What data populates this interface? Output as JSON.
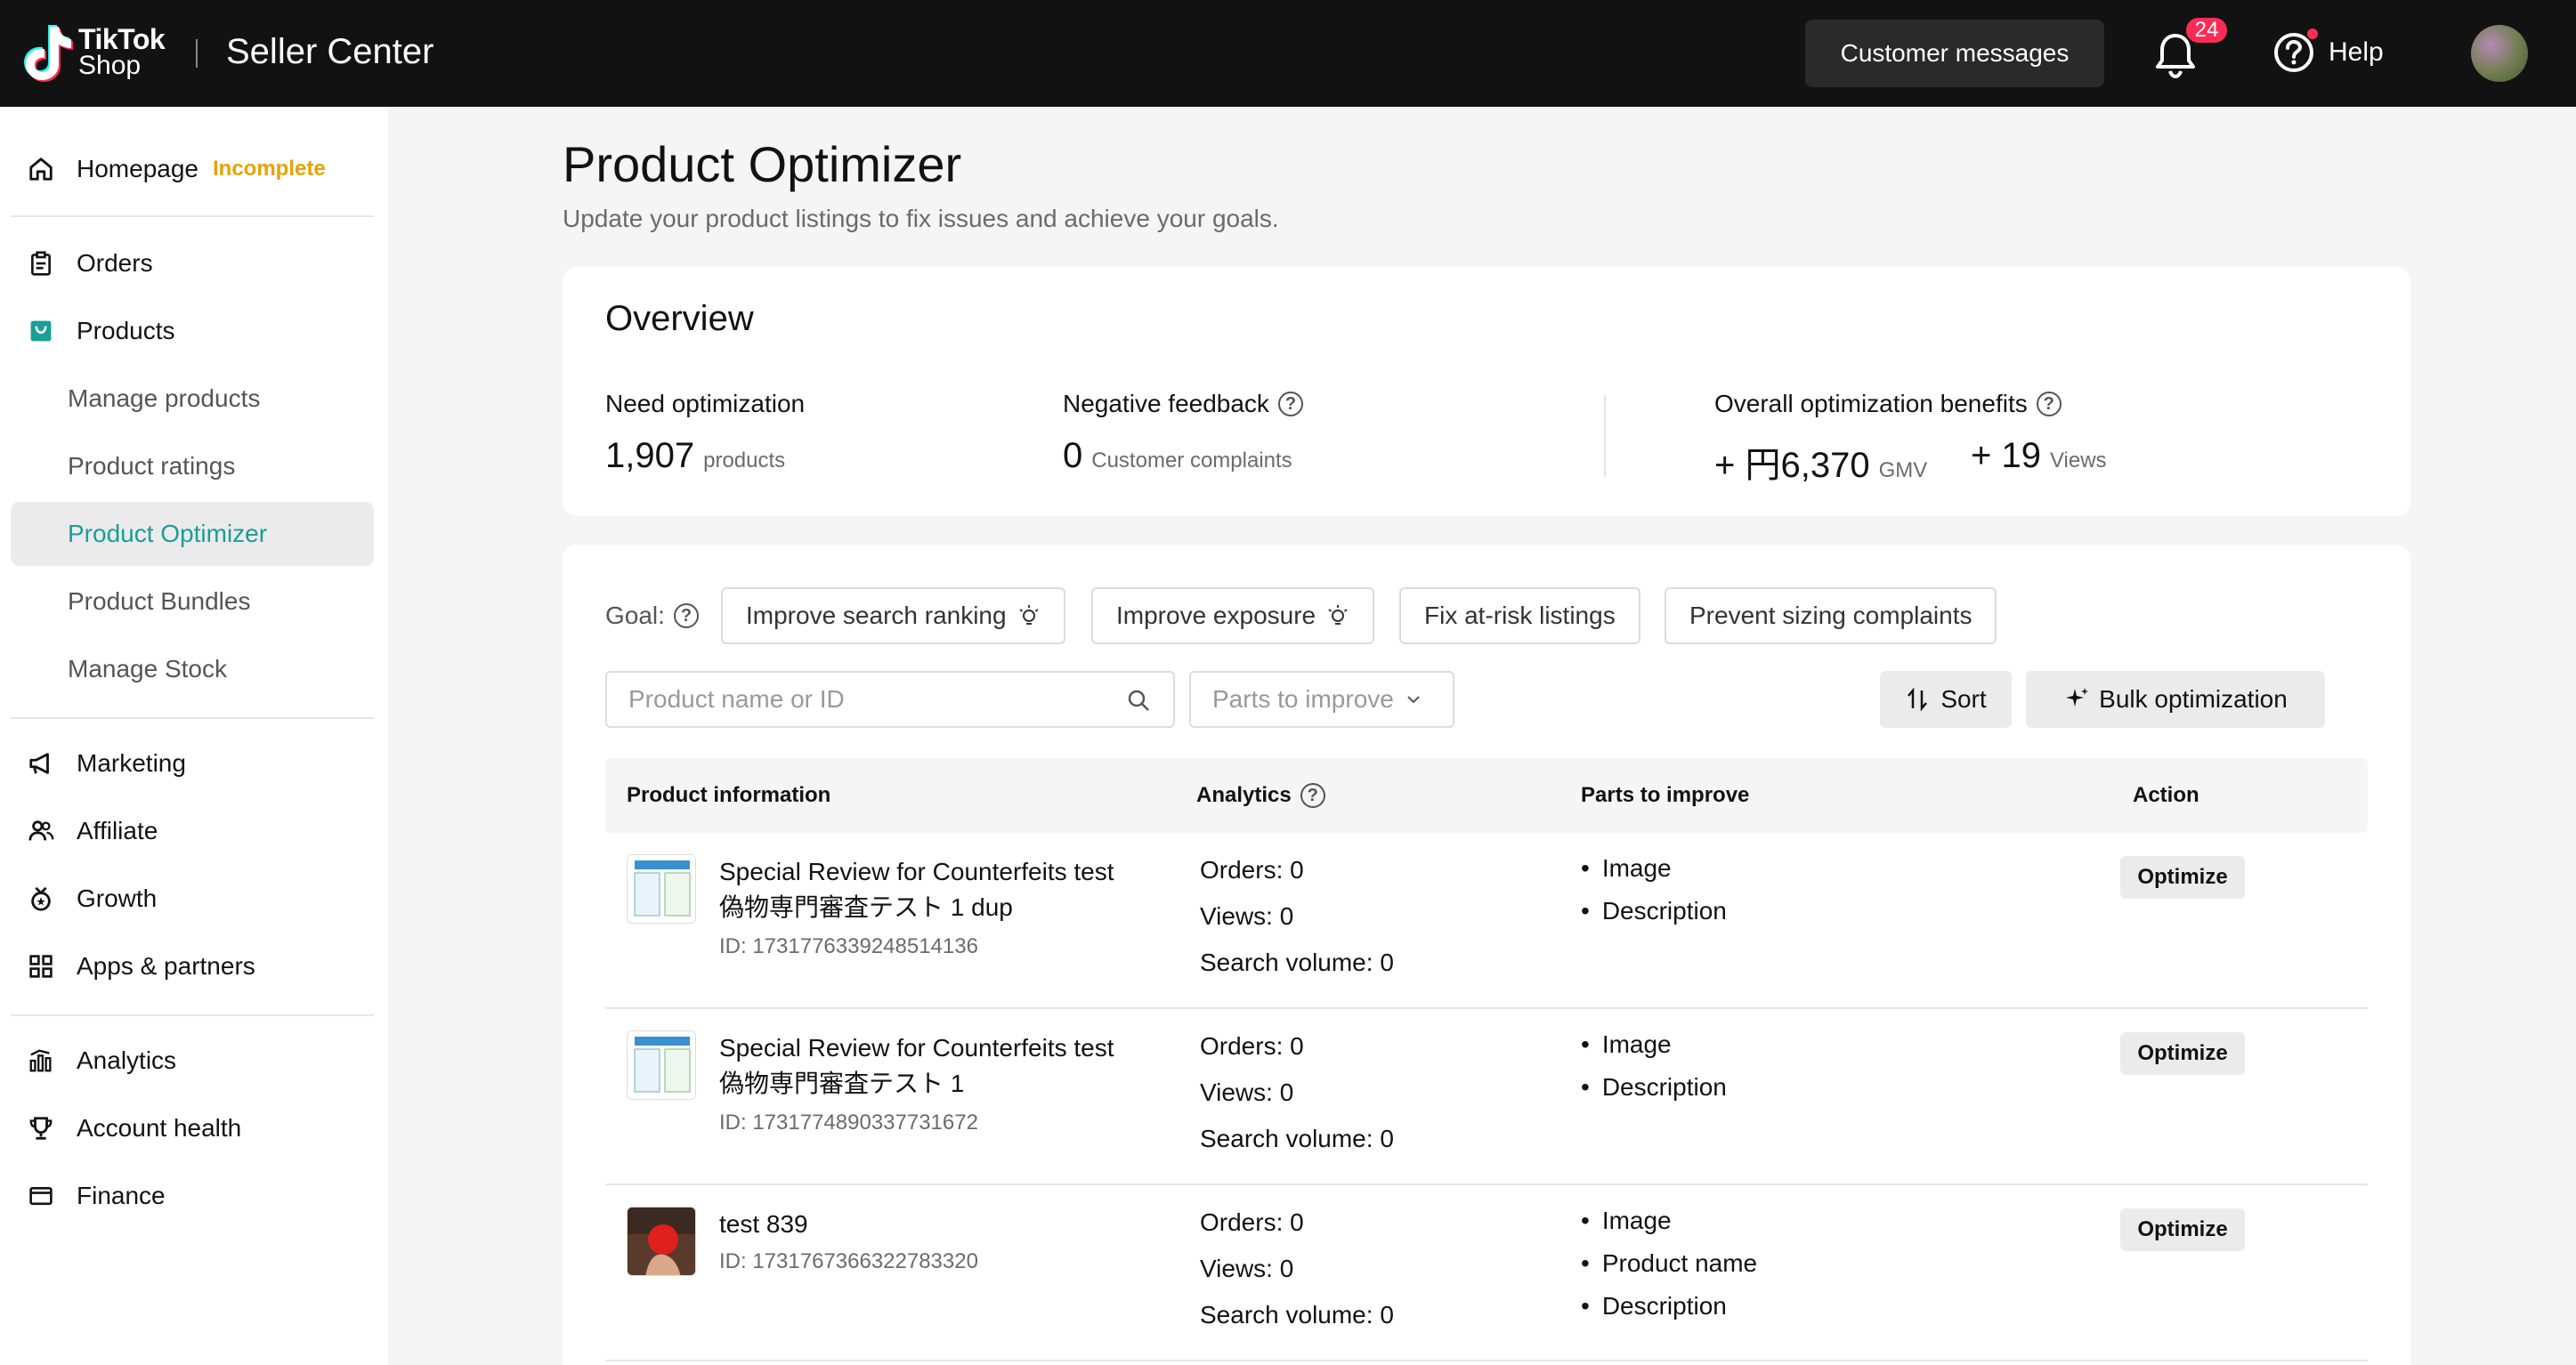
{
  "header": {
    "logo_line1": "TikTok",
    "logo_line2": "Shop",
    "app_name": "Seller Center",
    "customer_messages": "Customer messages",
    "notification_count": "24",
    "help": "Help"
  },
  "sidebar": {
    "homepage": "Homepage",
    "homepage_status": "Incomplete",
    "orders": "Orders",
    "products": "Products",
    "manage_products": "Manage products",
    "product_ratings": "Product ratings",
    "product_optimizer": "Product Optimizer",
    "product_bundles": "Product Bundles",
    "manage_stock": "Manage Stock",
    "marketing": "Marketing",
    "affiliate": "Affiliate",
    "growth": "Growth",
    "apps_partners": "Apps & partners",
    "analytics": "Analytics",
    "account_health": "Account health",
    "finance": "Finance"
  },
  "page": {
    "title": "Product Optimizer",
    "subtitle": "Update your product listings to fix issues and achieve your goals."
  },
  "overview": {
    "title": "Overview",
    "need_opt_label": "Need optimization",
    "need_opt_value": "1,907",
    "need_opt_unit": "products",
    "neg_label": "Negative feedback",
    "neg_value": "0",
    "neg_unit": "Customer complaints",
    "benefits_label": "Overall optimization benefits",
    "gmv_value": "+ 円6,370",
    "gmv_unit": "GMV",
    "views_value": "+ 19",
    "views_unit": "Views"
  },
  "filters": {
    "goal_label": "Goal:",
    "goals": [
      "Improve search ranking",
      "Improve exposure",
      "Fix at-risk listings",
      "Prevent sizing complaints"
    ],
    "search_placeholder": "Product name or ID",
    "parts_placeholder": "Parts to improve",
    "sort": "Sort",
    "bulk": "Bulk optimization"
  },
  "table": {
    "headers": {
      "product": "Product information",
      "analytics": "Analytics",
      "parts": "Parts to improve",
      "action": "Action"
    },
    "rows": [
      {
        "name_line1": "Special Review for Counterfeits test",
        "name_line2": "偽物専門審査テスト 1 dup",
        "id": "ID: 1731776339248514136",
        "orders": "Orders: 0",
        "views": "Views: 0",
        "search": "Search volume: 0",
        "parts": [
          "Image",
          "Description"
        ],
        "action": "Optimize"
      },
      {
        "name_line1": "Special Review for Counterfeits test",
        "name_line2": "偽物専門審査テスト 1",
        "id": "ID: 1731774890337731672",
        "orders": "Orders: 0",
        "views": "Views: 0",
        "search": "Search volume: 0",
        "parts": [
          "Image",
          "Description"
        ],
        "action": "Optimize"
      },
      {
        "name_line1": "test 839",
        "id": "ID: 1731767366322783320",
        "orders": "Orders: 0",
        "views": "Views: 0",
        "search": "Search volume: 0",
        "parts": [
          "Image",
          "Product name",
          "Description"
        ],
        "action": "Optimize"
      }
    ]
  }
}
